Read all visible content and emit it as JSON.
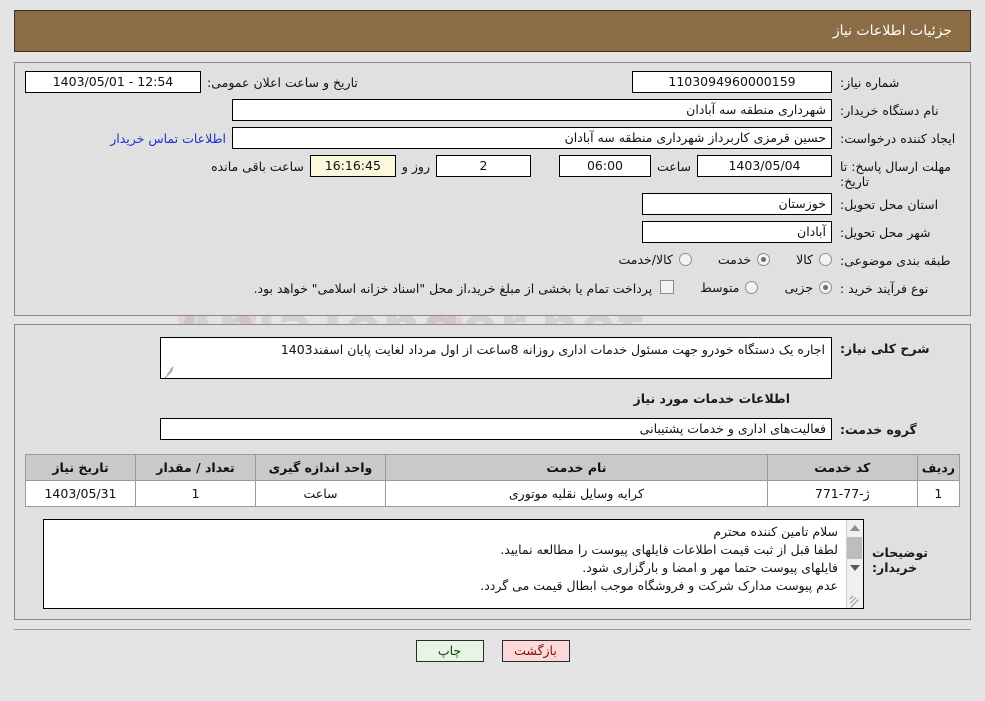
{
  "header": {
    "title": "جزئیات اطلاعات نیاز"
  },
  "form": {
    "need_number": {
      "label": "شماره نیاز:",
      "value": "1103094960000159"
    },
    "public_announce": {
      "label": "تاریخ و ساعت اعلان عمومی:",
      "value": "1403/05/01 - 12:54"
    },
    "buyer_org": {
      "label": "نام دستگاه خریدار:",
      "value": "شهرداری منطقه سه آبادان"
    },
    "creator": {
      "label": "ایجاد کننده درخواست:",
      "value": "حسین قرمزی کاربرداز شهرداری منطقه سه آبادان"
    },
    "contact_link": {
      "label": "اطلاعات تماس خریدار"
    },
    "deadline": {
      "label_line1": "مهلت ارسال پاسخ: تا",
      "label_line2": "تاریخ:",
      "date": "1403/05/04",
      "hour_label": "ساعت",
      "hour": "06:00",
      "days": "2",
      "days_label": "روز و",
      "countdown": "16:16:45",
      "remaining_label": "ساعت باقی مانده"
    },
    "province": {
      "label": "استان محل تحویل:",
      "value": "خوزستان"
    },
    "city": {
      "label": "شهر محل تحویل:",
      "value": "آبادان"
    },
    "classification": {
      "label": "طبقه بندی موضوعی:",
      "options": [
        {
          "label": "کالا",
          "selected": false
        },
        {
          "label": "خدمت",
          "selected": true
        },
        {
          "label": "کالا/خدمت",
          "selected": false
        }
      ]
    },
    "purchase_type": {
      "label": "نوع فرآیند خرید :",
      "options": [
        {
          "label": "جزیی",
          "selected": true
        },
        {
          "label": "متوسط",
          "selected": false
        }
      ],
      "checkbox_label": "پرداخت تمام یا بخشی از مبلغ خرید،از محل \"اسناد خزانه اسلامی\" خواهد بود.",
      "checkbox_checked": false
    }
  },
  "details": {
    "need_desc": {
      "label": "شرح کلی نیاز:",
      "value": "اجاره یک دستگاه خودرو جهت مسئول خدمات اداری روزانه 8ساعت از اول مرداد لغایت پایان اسفند1403"
    },
    "section_title": "اطلاعات خدمات مورد نیاز",
    "service_group": {
      "label": "گروه خدمت:",
      "value": "فعالیت‌های اداری و خدمات پشتیبانی"
    },
    "table": {
      "columns": [
        "ردیف",
        "کد خدمت",
        "نام خدمت",
        "واحد اندازه گیری",
        "تعداد / مقدار",
        "تاریخ نیاز"
      ],
      "rows": [
        {
          "radif": "1",
          "code": "ژ-77-771",
          "name": "کرایه وسایل نقلیه موتوری",
          "unit": "ساعت",
          "qty": "1",
          "date": "1403/05/31"
        }
      ]
    },
    "buyer_notes": {
      "label": "توضیحات خریدار:",
      "lines": [
        "سلام تامین کننده محترم",
        "لطفا قبل از ثبت قیمت اطلاعات فایلهای پیوست را مطالعه نمایید.",
        "فایلهای پیوست حتما مهر و امضا و بارگزاری شود.",
        "عدم پیوست مدارک شرکت و فروشگاه موجب ابطال قیمت می گردد."
      ]
    }
  },
  "footer": {
    "print_label": "چاپ",
    "return_label": "بازگشت"
  },
  "watermark": {
    "text1": "AniaTender.net",
    "text2": "TenderNet",
    "letter": "W"
  },
  "colors": {
    "header_bg": "#8a6c45",
    "panel_bg": "#e0e0e0",
    "page_bg": "#e4e4e4",
    "link": "#1b33cf",
    "countdown_bg": "#fbf8dc",
    "table_header_bg": "#c9c9c9",
    "print_btn_bg": "#e7f5e4",
    "return_btn_bg": "#fbd9d9"
  }
}
